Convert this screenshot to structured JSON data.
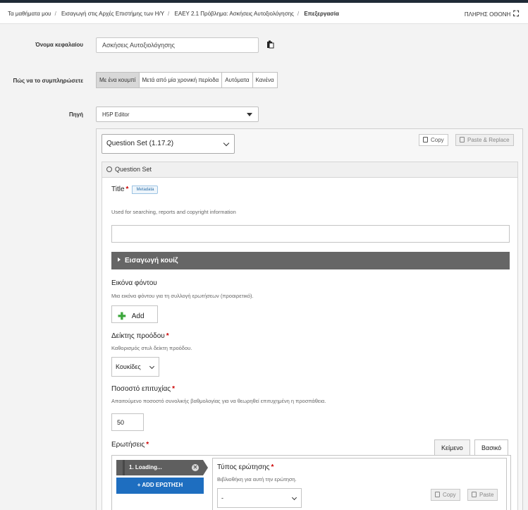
{
  "breadcrumb": {
    "items": [
      "Τα μαθήματα μου",
      "Εισαγωγή στις Αρχές Επιστήμης των Η/Υ",
      "ΕΑΕΥ 2.1 Πρόβλημα: Ασκήσεις Αυτοξιολόγησης"
    ],
    "current": "Επεξεργασία",
    "separator": "/",
    "fullscreen_label": "ΠΛΗΡΗΣ ΟΘΟΝΗ",
    "fullscreen_icon": "⛶"
  },
  "form": {
    "chapter_name_label": "Όνομα κεφαλαίου",
    "chapter_name_value": "Ασκήσεις Αυτοξιολόγησης",
    "completion_label": "Πώς να το συμπληρώσετε",
    "completion_options": [
      "Με ένα κουμπί",
      "Μετά από μία χρονική περίοδα",
      "Αυτόματα",
      "Κανένα"
    ],
    "completion_selected": "Με ένα κουμπί",
    "source_label": "Πηγή",
    "source_value": "H5P Editor"
  },
  "editor": {
    "library_value": "Question Set (1.17.2)",
    "copy_label": "Copy",
    "paste_label": "Paste & Replace",
    "panel_title": "Question Set",
    "title_field": {
      "label": "Title",
      "metadata_label": "Metadata",
      "description": "Used for searching, reports and copyright information",
      "value": ""
    },
    "intro_label": "Εισαγωγή κουίζ",
    "bg_image": {
      "label": "Εικόνα φόντου",
      "description": "Μια εικόνα φόντου για τη συλλογή ερωτήσεων (προαιρετικό).",
      "add_label": "Add"
    },
    "progress": {
      "label": "Δείκτης προόδου",
      "description": "Καθορισμός στυλ δείκτη προόδου.",
      "value": "Κουκίδες"
    },
    "pass_pct": {
      "label": "Ποσοστό επιτυχίας",
      "description": "Απαιτούμενο ποσοστό συνολικής βαθμολογίας για να θεωρηθεί επιτυχημένη η προσπάθεια.",
      "value": "50"
    },
    "questions": {
      "label": "Ερωτήσεις",
      "tab_text": "Κείμενο",
      "tab_basic": "Βασικό",
      "item_label": "1. Loading...",
      "add_label": "ADD ΕΡΩΤΗΣΗ",
      "type_label": "Τύπος ερώτησης",
      "type_description": "Βιβλιοθήκη για αυτή την ερώτηση.",
      "type_value": "-",
      "copy_label": "Copy",
      "paste_label": "Paste"
    }
  },
  "colors": {
    "accent_blue": "#1e6ec0",
    "required_star": "#cc0000",
    "collapsible_bar": "#666666"
  }
}
